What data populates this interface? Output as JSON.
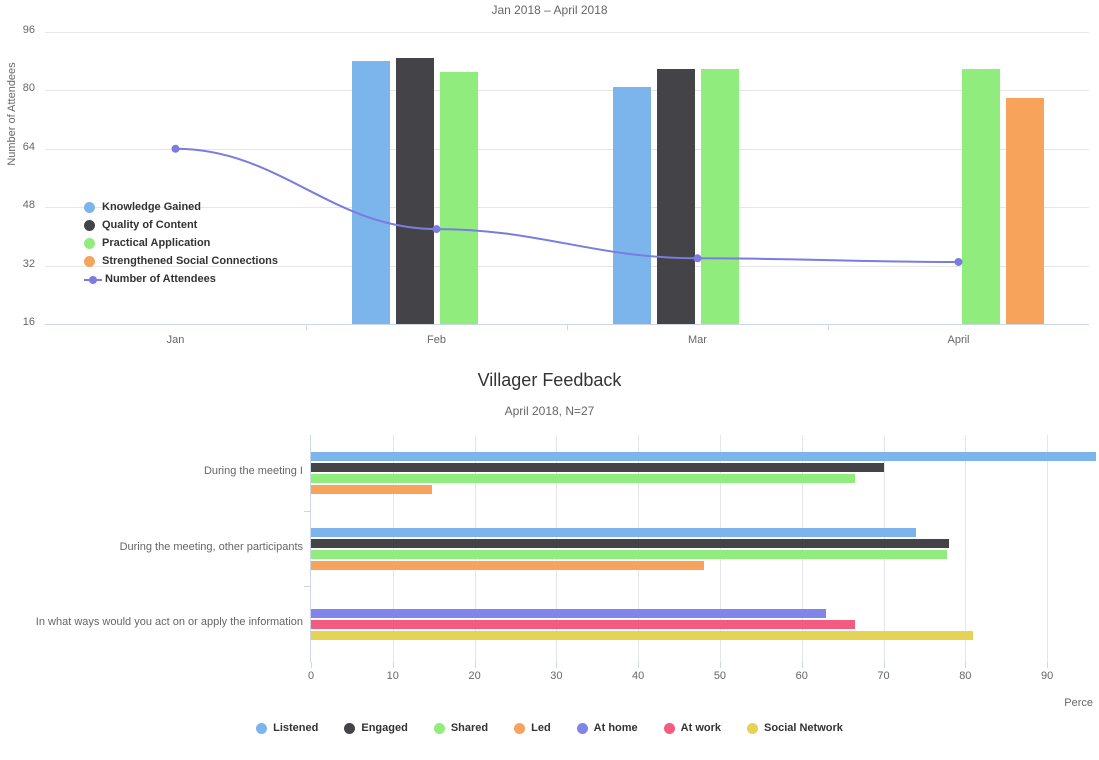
{
  "colors": {
    "listened": "#7cb5ec",
    "engaged": "#434348",
    "shared": "#90ed7d",
    "led": "#f7a35c",
    "at_home": "#8085e9",
    "at_work": "#f15c80",
    "social_network": "#e4d354",
    "line": "#7b7be0",
    "grid": "#e6e6e6",
    "axis": "#ccd6eb",
    "text": "#666666",
    "title": "#333333"
  },
  "chart_data": [
    {
      "type": "bar",
      "id": "attendance-chart",
      "title": "",
      "subtitle": "Jan 2018 – April 2018",
      "xlabel": "",
      "ylabel": "Number of Attendees",
      "categories": [
        "Jan",
        "Feb",
        "Mar",
        "April"
      ],
      "ytick_labels": [
        "96",
        "80",
        "64",
        "48",
        "32",
        "16"
      ],
      "ylim": [
        16,
        96
      ],
      "grid": true,
      "legend_position": "inside-left",
      "series": [
        {
          "name": "Knowledge Gained",
          "type": "column",
          "color": "#7cb5ec",
          "values": [
            null,
            88,
            81,
            null
          ]
        },
        {
          "name": "Quality of Content",
          "type": "column",
          "color": "#434348",
          "values": [
            null,
            89,
            86,
            null
          ]
        },
        {
          "name": "Practical Application",
          "type": "column",
          "color": "#90ed7d",
          "values": [
            null,
            85,
            86,
            86
          ]
        },
        {
          "name": "Strengthened Social Connections",
          "type": "column",
          "color": "#f7a35c",
          "values": [
            null,
            null,
            null,
            78
          ]
        },
        {
          "name": "Number of Attendees",
          "type": "line",
          "color": "#7b7be0",
          "values": [
            64,
            42,
            34,
            33
          ]
        }
      ]
    },
    {
      "type": "bar",
      "id": "villager-feedback-chart",
      "orientation": "horizontal",
      "title": "Villager Feedback",
      "subtitle": "April 2018, N=27",
      "xlabel": "Perce",
      "ylabel": "",
      "categories": [
        "During the meeting I",
        "During the meeting, other participants",
        "In what ways would you act on or apply the information"
      ],
      "xtick_labels": [
        "0",
        "10",
        "20",
        "30",
        "40",
        "50",
        "60",
        "70",
        "80",
        "90"
      ],
      "xlim": [
        0,
        95
      ],
      "grid": true,
      "legend_position": "bottom",
      "series": [
        {
          "name": "Listened",
          "color": "#7cb5ec",
          "values": [
            96,
            74,
            null
          ]
        },
        {
          "name": "Engaged",
          "color": "#434348",
          "values": [
            70,
            78,
            null
          ]
        },
        {
          "name": "Shared",
          "color": "#90ed7d",
          "values": [
            66.5,
            77.8,
            null
          ]
        },
        {
          "name": "Led",
          "color": "#f7a35c",
          "values": [
            14.8,
            48,
            null
          ]
        },
        {
          "name": "At home",
          "color": "#8085e9",
          "values": [
            null,
            null,
            63
          ]
        },
        {
          "name": "At work",
          "color": "#f15c80",
          "values": [
            null,
            null,
            66.5
          ]
        },
        {
          "name": "Social Network",
          "color": "#e4d354",
          "values": [
            null,
            null,
            81
          ]
        }
      ]
    }
  ]
}
